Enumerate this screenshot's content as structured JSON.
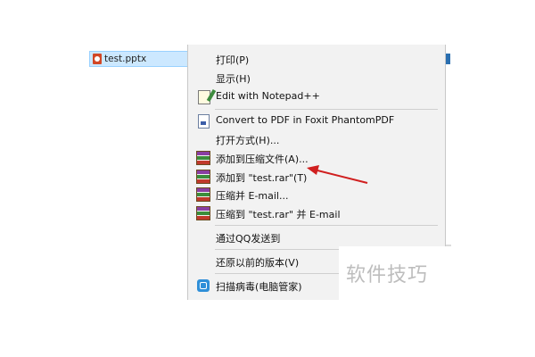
{
  "explorer": {
    "selected_file": "test.pptx"
  },
  "context_menu": {
    "items": [
      {
        "label": "打印(P)",
        "icon": null
      },
      {
        "label": "显示(H)",
        "icon": null
      },
      {
        "label": "Edit with Notepad++",
        "icon": "notepad-plus-plus-icon"
      },
      {
        "label": "Convert to PDF in Foxit PhantomPDF",
        "icon": "foxit-pdf-icon"
      },
      {
        "label": "打开方式(H)...",
        "icon": null
      },
      {
        "label": "添加到压缩文件(A)...",
        "icon": "winrar-icon"
      },
      {
        "label": "添加到 \"test.rar\"(T)",
        "icon": "winrar-icon"
      },
      {
        "label": "压缩并 E-mail...",
        "icon": "winrar-icon"
      },
      {
        "label": "压缩到 \"test.rar\" 并 E-mail",
        "icon": "winrar-icon"
      },
      {
        "label": "通过QQ发送到",
        "icon": null
      },
      {
        "label": "还原以前的版本(V)",
        "icon": null
      },
      {
        "label": "扫描病毒(电脑管家)",
        "icon": "tencent-pc-manager-icon"
      }
    ]
  },
  "annotation": {
    "arrow_color": "#d01f1f"
  },
  "watermark": {
    "text": "软件技巧"
  }
}
